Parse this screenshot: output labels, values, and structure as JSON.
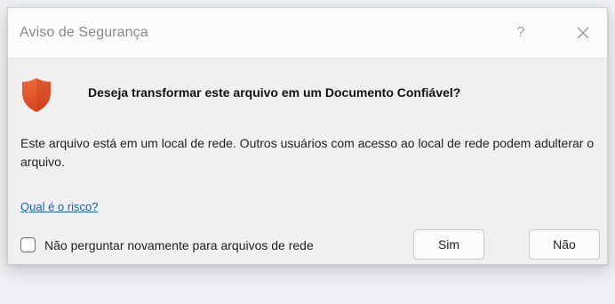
{
  "dialog": {
    "title": "Aviso de Segurança",
    "help_label": "?",
    "question": "Deseja transformar este arquivo em um Documento Confiável?",
    "message": "Este arquivo está em um local de rede. Outros usuários com acesso ao local de rede podem adulterar o arquivo.",
    "risk_link": "Qual é o risco?",
    "checkbox_label": "Não perguntar novamente para arquivos de rede",
    "checkbox_checked": false,
    "yes_label": "Sim",
    "no_label": "Não"
  },
  "colors": {
    "shield": "#e0522c",
    "link": "#1a5fb4"
  },
  "icons": [
    "shield-icon",
    "help-icon",
    "close-icon"
  ]
}
